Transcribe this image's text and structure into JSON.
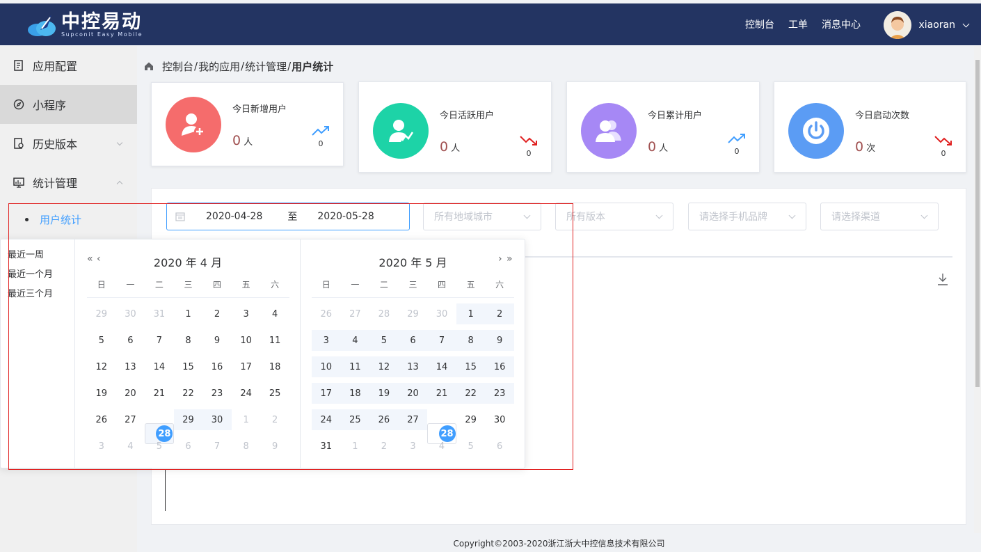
{
  "header": {
    "logo_title": "中控易动",
    "logo_sub": "Supconit Easy Mobile",
    "nav": [
      "控制台",
      "工单",
      "消息中心"
    ],
    "username": "xiaoran"
  },
  "sidebar": {
    "items": [
      {
        "label": "应用配置",
        "icon": "app-config-icon"
      },
      {
        "label": "小程序",
        "icon": "compass-icon"
      },
      {
        "label": "历史版本",
        "icon": "history-icon"
      },
      {
        "label": "统计管理",
        "icon": "monitor-icon"
      }
    ],
    "sub_item": "用户统计"
  },
  "breadcrumb": {
    "items": [
      "控制台",
      "我的应用",
      "统计管理"
    ],
    "current": "用户统计",
    "sep": "/"
  },
  "cards": [
    {
      "label": "今日新增用户",
      "value": "0",
      "unit": "人",
      "trend": "0",
      "trend_dir": "up",
      "color": "#f56c6c"
    },
    {
      "label": "今日活跃用户",
      "value": "0",
      "unit": "人",
      "trend": "0",
      "trend_dir": "down",
      "color": "#1dd3a7"
    },
    {
      "label": "今日累计用户",
      "value": "0",
      "unit": "人",
      "trend": "0",
      "trend_dir": "up",
      "color": "#a688f5"
    },
    {
      "label": "今日启动次数",
      "value": "0",
      "unit": "次",
      "trend": "0",
      "trend_dir": "down",
      "color": "#5b9cf4"
    }
  ],
  "filters": {
    "date_start": "2020-04-28",
    "date_to": "至",
    "date_end": "2020-05-28",
    "region_placeholder": "所有地域城市",
    "version_placeholder": "所有版本",
    "brand_placeholder": "请选择手机品牌",
    "channel_placeholder": "请选择渠道"
  },
  "picker": {
    "shortcuts": [
      "最近一周",
      "最近一个月",
      "最近三个月"
    ],
    "weekdays": [
      "日",
      "一",
      "二",
      "三",
      "四",
      "五",
      "六"
    ],
    "left_title": "2020 年 4 月",
    "right_title": "2020 年 5 月",
    "left_days": [
      [
        "29",
        "30",
        "31",
        "1",
        "2",
        "3",
        "4"
      ],
      [
        "5",
        "6",
        "7",
        "8",
        "9",
        "10",
        "11"
      ],
      [
        "12",
        "13",
        "14",
        "15",
        "16",
        "17",
        "18"
      ],
      [
        "19",
        "20",
        "21",
        "22",
        "23",
        "24",
        "25"
      ],
      [
        "26",
        "27",
        "28",
        "29",
        "30",
        "1",
        "2"
      ],
      [
        "3",
        "4",
        "5",
        "6",
        "7",
        "8",
        "9"
      ]
    ],
    "right_days": [
      [
        "26",
        "27",
        "28",
        "29",
        "30",
        "1",
        "2"
      ],
      [
        "3",
        "4",
        "5",
        "6",
        "7",
        "8",
        "9"
      ],
      [
        "10",
        "11",
        "12",
        "13",
        "14",
        "15",
        "16"
      ],
      [
        "17",
        "18",
        "19",
        "20",
        "21",
        "22",
        "23"
      ],
      [
        "24",
        "25",
        "26",
        "27",
        "28",
        "29",
        "30"
      ],
      [
        "31",
        "1",
        "2",
        "3",
        "4",
        "5",
        "6"
      ]
    ]
  },
  "footer": "Copyright©2003-2020浙江浙大中控信息技术有限公司"
}
